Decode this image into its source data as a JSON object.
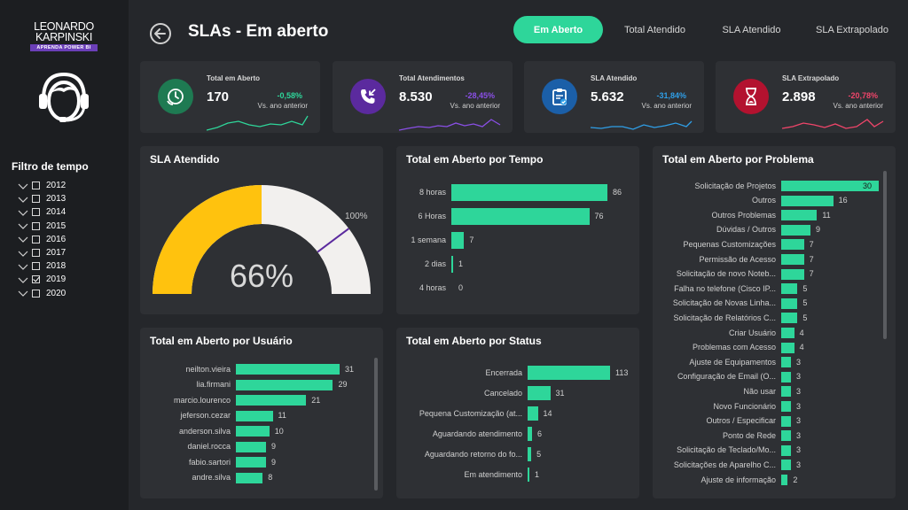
{
  "sidebar": {
    "logo": {
      "line1": "LEONARDO",
      "line2": "KARPINSKI",
      "tagline": "APRENDA POWER BI"
    },
    "filter_title": "Filtro de tempo",
    "years": [
      {
        "label": "2012",
        "checked": false
      },
      {
        "label": "2013",
        "checked": false
      },
      {
        "label": "2014",
        "checked": false
      },
      {
        "label": "2015",
        "checked": false
      },
      {
        "label": "2016",
        "checked": false
      },
      {
        "label": "2017",
        "checked": false
      },
      {
        "label": "2018",
        "checked": false
      },
      {
        "label": "2019",
        "checked": true
      },
      {
        "label": "2020",
        "checked": false
      }
    ]
  },
  "header": {
    "title": "SLAs - Em aberto",
    "tabs": [
      {
        "label": "Em Aberto",
        "active": true
      },
      {
        "label": "Total Atendido",
        "active": false
      },
      {
        "label": "SLA Atendido",
        "active": false
      },
      {
        "label": "SLA Extrapolado",
        "active": false
      }
    ]
  },
  "kpis": [
    {
      "label": "Total em Aberto",
      "value": "170",
      "pct": "-0,58%",
      "sub": "Vs. ano anterior",
      "color": "#2ed69a",
      "icon_bg": "#1e7a52",
      "icon": "phone-clock-icon"
    },
    {
      "label": "Total Atendimentos",
      "value": "8.530",
      "pct": "-28,45%",
      "sub": "Vs. ano anterior",
      "color": "#8a4fe6",
      "icon_bg": "#5b2a9e",
      "icon": "phone-incoming-icon"
    },
    {
      "label": "SLA Atendido",
      "value": "5.632",
      "pct": "-31,84%",
      "sub": "Vs. ano anterior",
      "color": "#2f9fe8",
      "icon_bg": "#1b5fa8",
      "icon": "clipboard-check-icon"
    },
    {
      "label": "SLA Extrapolado",
      "value": "2.898",
      "pct": "-20,78%",
      "sub": "Vs. ano anterior",
      "color": "#f0456a",
      "icon_bg": "#b3122f",
      "icon": "hourglass-icon"
    }
  ],
  "gauge": {
    "title": "SLA Atendido",
    "value_label": "66%",
    "max_label": "100%",
    "value": 66,
    "target": 100,
    "fill_color": "#ffc20e",
    "track_color": "#f2f0ee"
  },
  "tempo": {
    "title": "Total em Aberto por Tempo",
    "rows": [
      {
        "label": "8 horas",
        "value": 86
      },
      {
        "label": "6 Horas",
        "value": 76
      },
      {
        "label": "1 semana",
        "value": 7
      },
      {
        "label": "2 dias",
        "value": 1
      },
      {
        "label": "4 horas",
        "value": 0
      }
    ]
  },
  "problema": {
    "title": "Total em Aberto por Problema",
    "rows": [
      {
        "label": "Solicitação de Projetos",
        "value": 30
      },
      {
        "label": "Outros",
        "value": 16
      },
      {
        "label": "Outros Problemas",
        "value": 11
      },
      {
        "label": "Dúvidas / Outros",
        "value": 9
      },
      {
        "label": "Pequenas Customizações",
        "value": 7
      },
      {
        "label": "Permissão de Acesso",
        "value": 7
      },
      {
        "label": "Solicitação de novo Noteb...",
        "value": 7
      },
      {
        "label": "Falha no telefone (Cisco IP...",
        "value": 5
      },
      {
        "label": "Solicitação de Novas Linha...",
        "value": 5
      },
      {
        "label": "Solicitação de Relatórios C...",
        "value": 5
      },
      {
        "label": "Criar Usuário",
        "value": 4
      },
      {
        "label": "Problemas com Acesso",
        "value": 4
      },
      {
        "label": "Ajuste de Equipamentos",
        "value": 3
      },
      {
        "label": "Configuração de Email (O...",
        "value": 3
      },
      {
        "label": "Não usar",
        "value": 3
      },
      {
        "label": "Novo Funcionário",
        "value": 3
      },
      {
        "label": "Outros / Especificar",
        "value": 3
      },
      {
        "label": "Ponto de Rede",
        "value": 3
      },
      {
        "label": "Solicitação de Teclado/Mo...",
        "value": 3
      },
      {
        "label": "Solicitações de Aparelho C...",
        "value": 3
      },
      {
        "label": "Ajuste de informação",
        "value": 2
      }
    ]
  },
  "usuario": {
    "title": "Total em Aberto por Usuário",
    "rows": [
      {
        "label": "neilton.vieira",
        "value": 31
      },
      {
        "label": "lia.firmani",
        "value": 29
      },
      {
        "label": "marcio.lourenco",
        "value": 21
      },
      {
        "label": "jeferson.cezar",
        "value": 11
      },
      {
        "label": "anderson.silva",
        "value": 10
      },
      {
        "label": "daniel.rocca",
        "value": 9
      },
      {
        "label": "fabio.sartori",
        "value": 9
      },
      {
        "label": "andre.silva",
        "value": 8
      }
    ]
  },
  "status": {
    "title": "Total em Aberto por Status",
    "rows": [
      {
        "label": "Encerrada",
        "value": 113
      },
      {
        "label": "Cancelado",
        "value": 31
      },
      {
        "label": "Pequena Customização (at...",
        "value": 14
      },
      {
        "label": "Aguardando atendimento",
        "value": 6
      },
      {
        "label": "Aguardando retorno do fo...",
        "value": 5
      },
      {
        "label": "Em atendimento",
        "value": 1
      }
    ]
  },
  "bar_color": "#2ed69a"
}
